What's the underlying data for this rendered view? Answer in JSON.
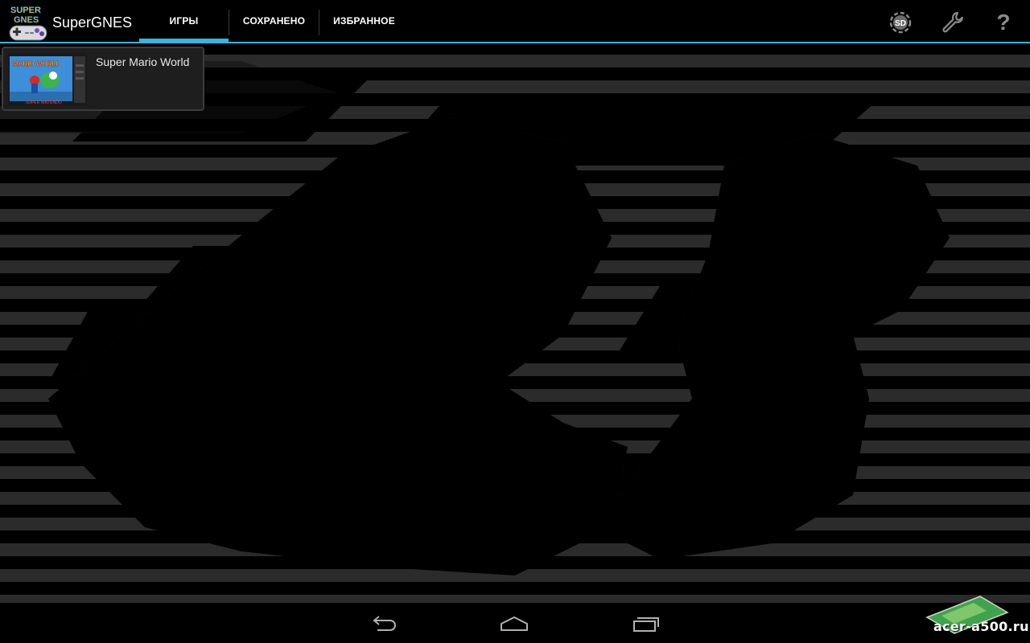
{
  "app": {
    "logo_text_line1": "SUPER",
    "logo_text_line2": "GNES",
    "title": "SuperGNES"
  },
  "tabs": [
    {
      "label": "ИГРЫ",
      "active": true
    },
    {
      "label": "СОХРАНЕНО",
      "active": false
    },
    {
      "label": "ИЗБРАННОЕ",
      "active": false
    }
  ],
  "actions": {
    "sd_label": "SD",
    "settings_icon": "wrench-icon",
    "help_label": "?"
  },
  "games": [
    {
      "title": "Super Mario World",
      "cover_text": "MARIO WORLD",
      "cover_subtext": "SUPER NINTENDO"
    }
  ],
  "navigation": {
    "back_icon": "back-icon",
    "home_icon": "home-icon",
    "recent_icon": "recent-apps-icon"
  },
  "watermark": {
    "text": "acer-a500.ru"
  },
  "colors": {
    "accent": "#33b5e5",
    "background": "#000000",
    "stripe": "#2b2b2b"
  }
}
